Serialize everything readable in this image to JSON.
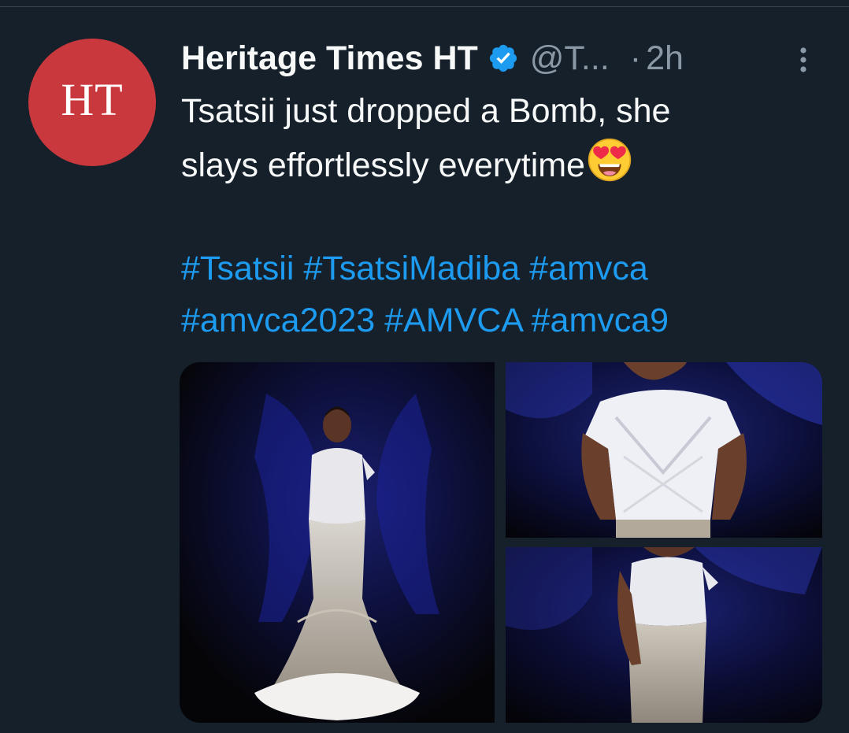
{
  "tweet": {
    "display_name": "Heritage Times HT",
    "handle": "@T...",
    "separator": "·",
    "time": "2h",
    "avatar_text": "HT",
    "text_line1": "Tsatsii just dropped a Bomb, she",
    "text_line2": "slays effortlessly everytime",
    "hashtags_line1": [
      "#Tsatsii",
      "#TsatsiMadiba",
      "#amvca"
    ],
    "hashtags_line2": [
      "#amvca2023",
      "#AMVCA",
      "#amvca9"
    ],
    "icons": {
      "verified": "verified-badge-icon",
      "more": "more-options-icon",
      "emoji": "heart-eyes-emoji-icon"
    },
    "colors": {
      "background": "#15202b",
      "text": "#f7f9f9",
      "secondary": "#8b98a5",
      "link": "#1d9bf0",
      "avatar": "#c9383d"
    }
  }
}
